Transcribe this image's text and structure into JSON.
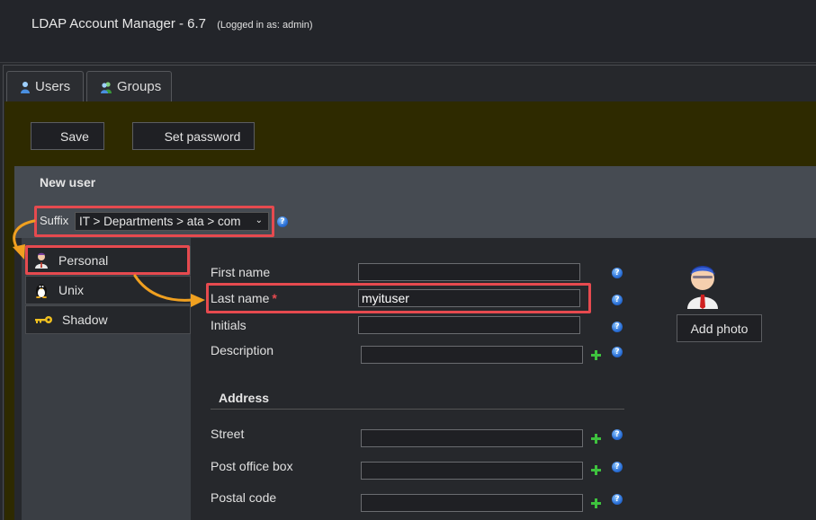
{
  "header": {
    "app_title": "LDAP Account Manager - 6.7",
    "login_status": "(Logged in as: admin)"
  },
  "tabs": [
    {
      "label": "Users",
      "icon": "user-icon"
    },
    {
      "label": "Groups",
      "icon": "groups-icon"
    }
  ],
  "toolbar": {
    "save_label": "Save",
    "set_password_label": "Set password"
  },
  "panel": {
    "title": "New user",
    "suffix_label": "Suffix",
    "suffix_value": "IT > Departments > ata > com"
  },
  "modules": [
    {
      "label": "Personal",
      "icon": "personal-icon",
      "selected": true
    },
    {
      "label": "Unix",
      "icon": "tux-penguin-icon",
      "selected": false
    },
    {
      "label": "Shadow",
      "icon": "key-icon",
      "selected": false
    }
  ],
  "form": {
    "first_name_label": "First name",
    "first_name_value": "",
    "last_name_label": "Last name",
    "required_marker": "*",
    "last_name_value": "myituser",
    "initials_label": "Initials",
    "initials_value": "",
    "description_label": "Description",
    "description_value": "",
    "address_title": "Address",
    "street_label": "Street",
    "street_value": "",
    "po_box_label": "Post office box",
    "po_box_value": "",
    "postal_code_label": "Postal code",
    "postal_code_value": ""
  },
  "photo": {
    "add_photo_label": "Add photo"
  },
  "colors": {
    "highlight": "#e64a4f",
    "annotation_arrow": "#f0a020",
    "olive_background": "#2e2a00"
  }
}
